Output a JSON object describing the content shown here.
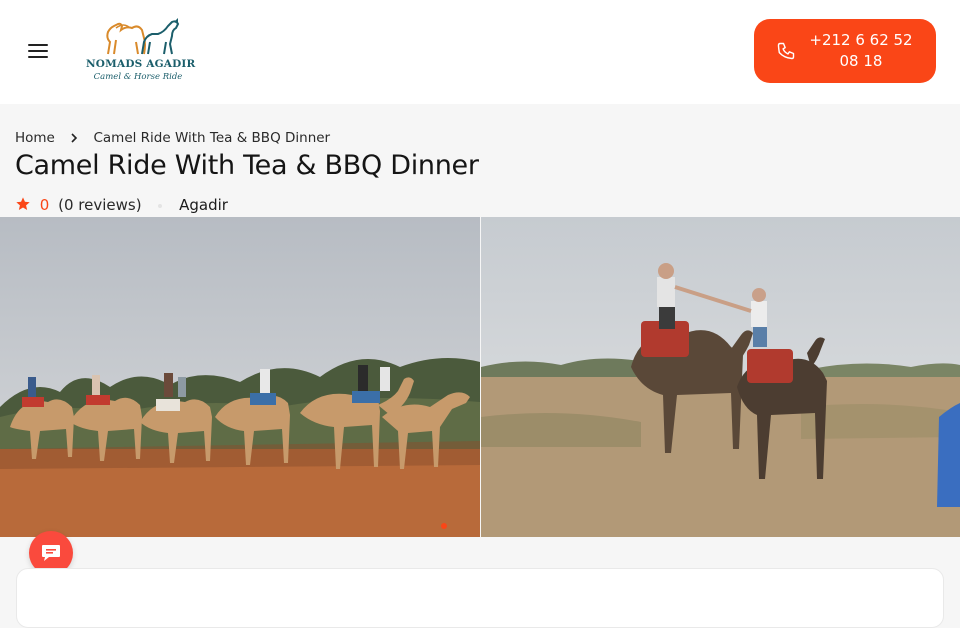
{
  "header": {
    "menu_icon": "hamburger-menu-icon",
    "logo": {
      "title": "NOMADS AGADIR",
      "subtitle": "Camel & Horse Ride"
    },
    "phone": {
      "icon": "phone-icon",
      "label": "+212 6 62 52 08 18"
    }
  },
  "breadcrumb": {
    "home": "Home",
    "separator_icon": "chevron-right-icon",
    "current": "Camel Ride With Tea & BBQ Dinner"
  },
  "tour": {
    "title": "Camel Ride With Tea & BBQ Dinner",
    "rating": "0",
    "reviews": "(0 reviews)",
    "location": "Agadir",
    "star_icon": "star-icon"
  },
  "gallery": {
    "images": [
      "camel-caravan-photo",
      "couple-on-camels-photo"
    ],
    "active_index": 0,
    "dots_count": 2
  },
  "chat": {
    "icon": "chat-bubble-icon"
  },
  "colors": {
    "accent": "#fa4617",
    "teal": "#1b5e6b",
    "logo_orange": "#d98a2b",
    "chat": "#fa4a3d"
  }
}
